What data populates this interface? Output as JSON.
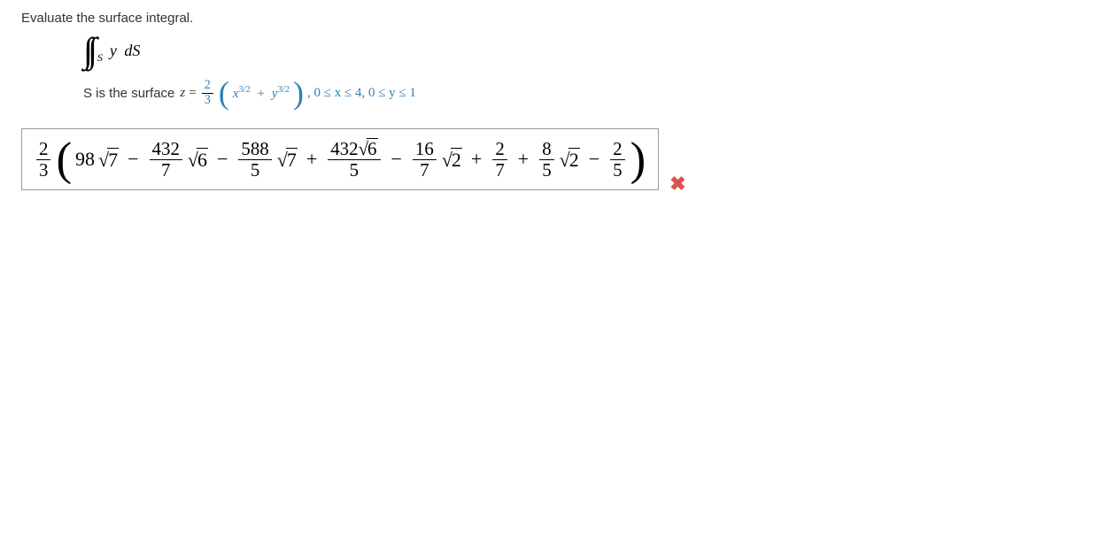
{
  "question": {
    "prompt": "Evaluate the surface integral.",
    "integral_var": "y",
    "integral_diff": "dS",
    "integral_region": "S",
    "surface_prefix": "S is the surface",
    "surface_var": "z",
    "surface_eq_sign": "=",
    "coeff_num": "2",
    "coeff_den": "3",
    "term1_base": "x",
    "term1_exp": "3/2",
    "term_plus": "+",
    "term2_base": "y",
    "term2_exp": "3/2",
    "bounds": ", 0 ≤ x ≤ 4, 0 ≤ y ≤ 1"
  },
  "answer": {
    "lead_num": "2",
    "lead_den": "3",
    "t1_coef": "98",
    "t1_rad": "7",
    "t2_num": "432",
    "t2_den": "7",
    "t2_rad": "6",
    "t3_num": "588",
    "t3_den": "5",
    "t3_rad": "7",
    "t4_num_coef": "432",
    "t4_num_rad": "6",
    "t4_den": "5",
    "t5_num": "16",
    "t5_den": "7",
    "t5_rad": "2",
    "t6_num": "2",
    "t6_den": "7",
    "t7_num": "8",
    "t7_den": "5",
    "t7_rad": "2",
    "t8_num": "2",
    "t8_den": "5",
    "minus": "−",
    "plus": "+"
  },
  "feedback": {
    "incorrect_glyph": "✖"
  }
}
